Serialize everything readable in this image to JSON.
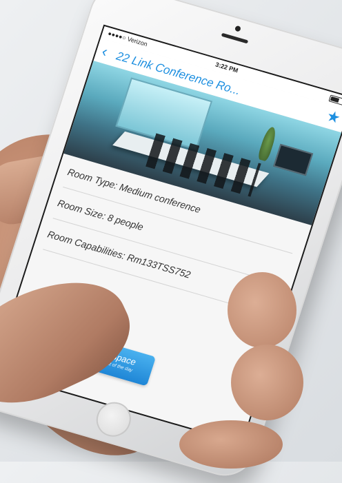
{
  "status_bar": {
    "carrier": "●●●●○ Verizon",
    "time": "3:22 PM"
  },
  "nav": {
    "back_icon": "chevron-left",
    "title": "22 Link Conference Ro...",
    "star_icon": "star"
  },
  "room": {
    "type": "Room Type: Medium conference",
    "size": "Room Size: 8 people",
    "capabilities": "Room Capabilities: Rm133TSS752"
  },
  "book": {
    "label": "Book This Space",
    "sublabel": "Available for the rest of the day"
  },
  "colors": {
    "accent": "#1d8fe0"
  }
}
